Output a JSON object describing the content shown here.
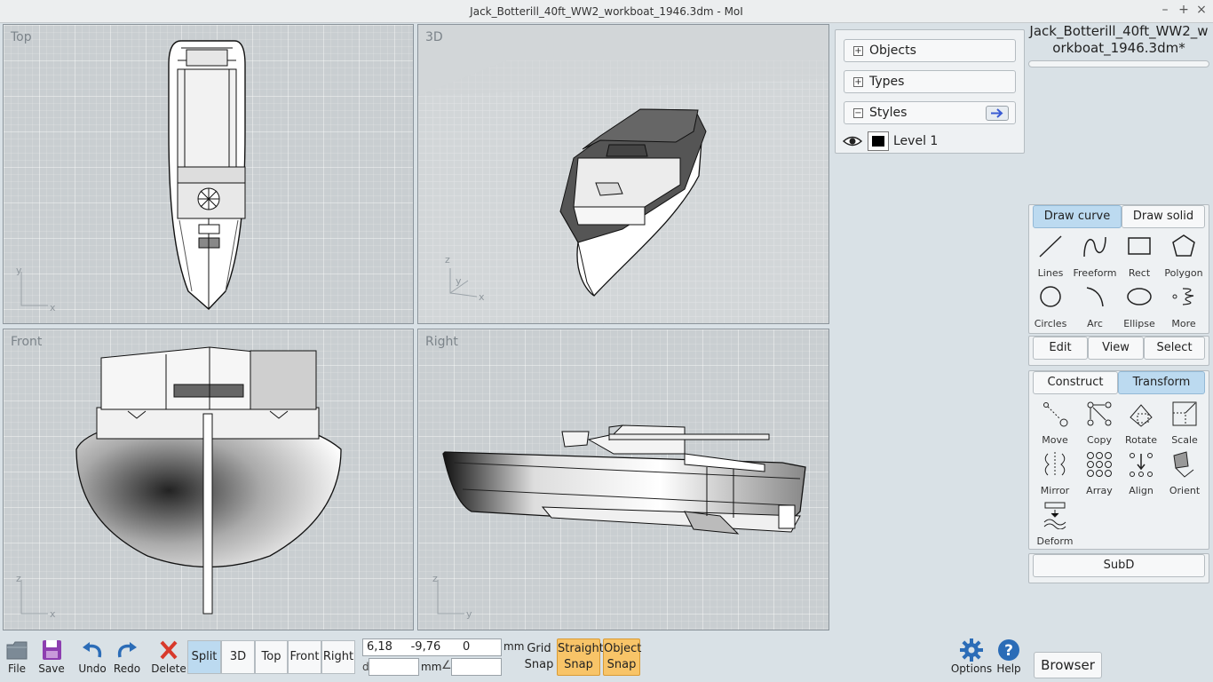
{
  "window": {
    "title": "Jack_Botterill_40ft_WW2_workboat_1946.3dm - MoI",
    "minimize": "–",
    "maximize": "+",
    "close": "×"
  },
  "viewports": {
    "top": {
      "label": "Top",
      "ax1": "y",
      "ax2": "x"
    },
    "3d": {
      "label": "3D",
      "ax1": "z",
      "ax2": "y",
      "ax3": "x"
    },
    "front": {
      "label": "Front",
      "ax1": "z",
      "ax2": "x"
    },
    "right": {
      "label": "Right",
      "ax1": "z",
      "ax2": "y"
    }
  },
  "scene": {
    "objects_label": "Objects",
    "types_label": "Types",
    "styles_label": "Styles",
    "expand": "+",
    "collapse": "−",
    "level_name": "Level 1"
  },
  "file_name": "Jack_Botterill_40ft_WW2_workboat_1946.3dm*",
  "draw_tabs": {
    "curve": "Draw curve",
    "solid": "Draw solid"
  },
  "draw_tools": [
    "Lines",
    "Freeform",
    "Rect",
    "Polygon",
    "Circles",
    "Arc",
    "Ellipse",
    "More"
  ],
  "mid_tabs": [
    "Edit",
    "View",
    "Select"
  ],
  "transform_tabs": {
    "construct": "Construct",
    "transform": "Transform"
  },
  "transform_tools": [
    "Move",
    "Copy",
    "Rotate",
    "Scale",
    "Mirror",
    "Array",
    "Align",
    "Orient",
    "Deform"
  ],
  "subd": "SubD",
  "bottom": {
    "file": "File",
    "save": "Save",
    "undo": "Undo",
    "redo": "Redo",
    "delete": "Delete"
  },
  "views": [
    "Split",
    "3D",
    "Top",
    "Front",
    "Right"
  ],
  "coords": {
    "value": "6,18     -9,76      0",
    "unit": "mm",
    "d_label": "d",
    "d_unit": "mm",
    "angle_symbol": "∠"
  },
  "snaps": {
    "grid": "Grid\nSnap",
    "straight_1": "Straight",
    "straight_2": "Snap",
    "object_1": "Object",
    "object_2": "Snap"
  },
  "right_bottom": {
    "options": "Options",
    "help": "Help",
    "browser": "Browser"
  },
  "colors": {
    "accent": "#bcdaf0",
    "snap": "#f8c468",
    "delete": "#d8392b",
    "blue_icon": "#2b6cb7"
  }
}
